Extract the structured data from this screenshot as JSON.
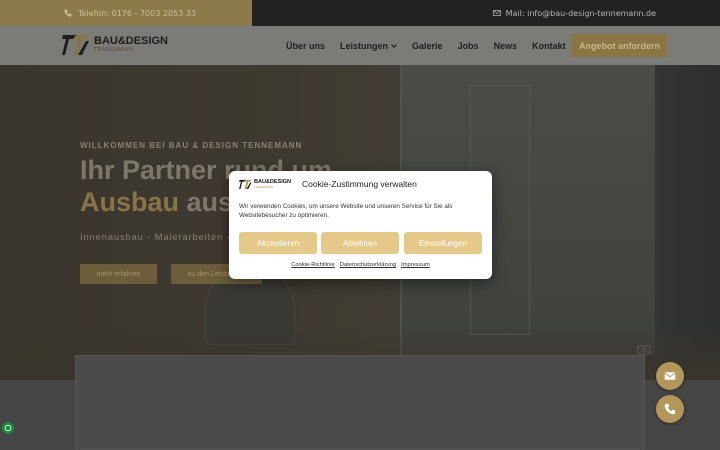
{
  "topbar": {
    "phone": "Telefon: 0176 - 7003 2053 33",
    "mail": "Mail: info@bau-design-tennemann.de"
  },
  "logo": {
    "title": "BAU&DESIGN",
    "subtitle": "TENNEMANN"
  },
  "nav": {
    "items": [
      {
        "label": "Über uns"
      },
      {
        "label": "Leistungen"
      },
      {
        "label": "Galerie"
      },
      {
        "label": "Jobs"
      },
      {
        "label": "News"
      },
      {
        "label": "Kontakt"
      }
    ],
    "cta": "Angebot anfordern"
  },
  "hero": {
    "eyebrow": "WILLKOMMEN BEI BAU & DESIGN TENNEMANN",
    "line1": "Ihr Partner rund um",
    "line2_gold": "Ausbau",
    "line2_rest": " aus",
    "services": "Innenausbau - Malerarbeiten - Fl",
    "btn1": "mehr erfahren",
    "btn2": "zu den Leistungen"
  },
  "cookie": {
    "title": "Cookie-Zustimmung verwalten",
    "text": "Wir verwenden Cookies, um unsere Website und unseren Service für Sie als Websitebesucher zu optimieren.",
    "accept": "Akzeptieren",
    "reject": "Ablehnen",
    "settings": "Einstellungen",
    "links": [
      "Cookie-Richtlinie",
      "Datenschutzerklärung",
      "Impressum"
    ],
    "logo_title": "BAU&DESIGN",
    "logo_subtitle": "TENNEMANN"
  },
  "colors": {
    "gold": "#e4c98a",
    "fab": "#b3975a"
  }
}
